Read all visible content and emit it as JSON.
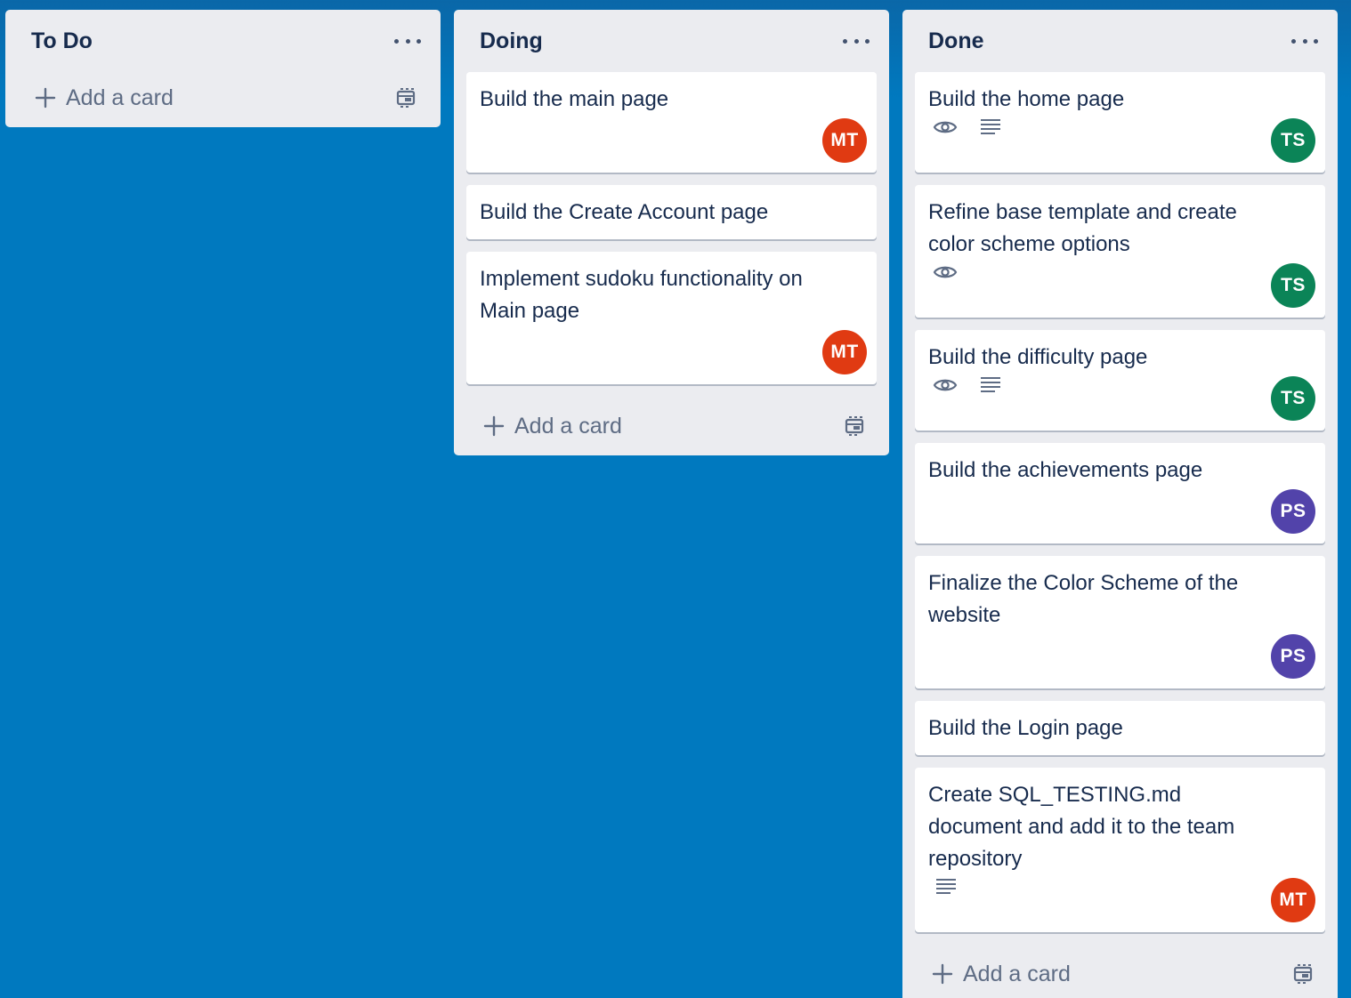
{
  "colors": {
    "board_bg": "#0079bf",
    "list_bg": "#ebecf0",
    "card_bg": "#ffffff",
    "text": "#172b4d",
    "muted": "#5e6c84",
    "avatar_MT": "#e03a12",
    "avatar_TS": "#0b8457",
    "avatar_PS": "#5243aa"
  },
  "lists": [
    {
      "title": "To Do",
      "add_card_label": "Add a card",
      "cards": []
    },
    {
      "title": "Doing",
      "add_card_label": "Add a card",
      "cards": [
        {
          "title": "Build the main page",
          "avatar": "MT",
          "watch": false,
          "description": false
        },
        {
          "title": "Build the Create Account page",
          "avatar": "",
          "watch": false,
          "description": false
        },
        {
          "title": "Implement sudoku functionality on Main page",
          "avatar": "MT",
          "watch": false,
          "description": false
        }
      ]
    },
    {
      "title": "Done",
      "add_card_label": "Add a card",
      "cards": [
        {
          "title": "Build the home page",
          "avatar": "TS",
          "watch": true,
          "description": true
        },
        {
          "title": "Refine base template and create color scheme options",
          "avatar": "TS",
          "watch": true,
          "description": false
        },
        {
          "title": "Build the difficulty page",
          "avatar": "TS",
          "watch": true,
          "description": true
        },
        {
          "title": "Build the achievements page",
          "avatar": "PS",
          "watch": false,
          "description": false
        },
        {
          "title": "Finalize the Color Scheme of the website",
          "avatar": "PS",
          "watch": false,
          "description": false
        },
        {
          "title": "Build the Login page",
          "avatar": "",
          "watch": false,
          "description": false
        },
        {
          "title": "Create SQL_TESTING.md document and add it to the team repository",
          "avatar": "MT",
          "watch": false,
          "description": true
        }
      ]
    }
  ],
  "icons": {
    "list_menu": "more-horizontal-icon",
    "add": "plus-icon",
    "template": "card-template-icon",
    "watch": "eye-icon",
    "description": "description-lines-icon"
  }
}
